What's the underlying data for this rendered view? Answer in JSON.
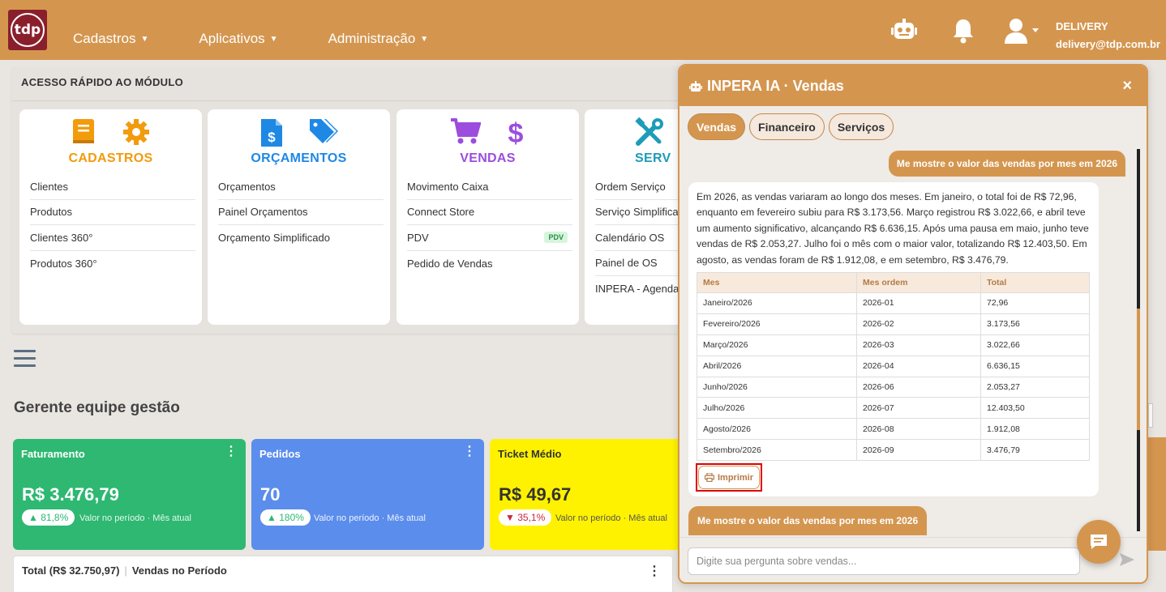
{
  "navbar": {
    "logo_text": "tdp",
    "menu": [
      {
        "label": "Cadastros"
      },
      {
        "label": "Aplicativos"
      },
      {
        "label": "Administração"
      }
    ],
    "user_name": "DELIVERY",
    "user_email": "delivery@tdp.com.br"
  },
  "quick_access": {
    "title": "ACESSO RÁPIDO AO MÓDULO",
    "cards": [
      {
        "title": "CADASTROS",
        "color": "#f29b0c",
        "items": [
          "Clientes",
          "Produtos",
          "Clientes 360°",
          "Produtos 360°"
        ]
      },
      {
        "title": "ORÇAMENTOS",
        "color": "#1e88e5",
        "items": [
          "Orçamentos",
          "Painel Orçamentos",
          "Orçamento Simplificado"
        ]
      },
      {
        "title": "VENDAS",
        "color": "#9c4ddd",
        "items": [
          "Movimento Caixa",
          "Connect Store",
          "PDV",
          "Pedido de Vendas"
        ],
        "badge": "PDV"
      },
      {
        "title": "SERV",
        "color": "#1c9cb8",
        "items": [
          "Ordem Serviço",
          "Serviço Simplifica",
          "Calendário OS",
          "Painel de OS",
          "INPERA - Agenda"
        ]
      }
    ]
  },
  "section_title": "Gerente equipe gestão",
  "kpis": [
    {
      "label": "Faturamento",
      "value": "R$ 3.476,79",
      "change": "81,8%",
      "meta": "Valor no período · Mês atual",
      "color": "#2eb872"
    },
    {
      "label": "Pedidos",
      "value": "70",
      "change": "180%",
      "meta": "Valor no período · Mês atual",
      "color": "#5b8dec"
    },
    {
      "label": "Ticket Médio",
      "value": "R$ 49,67",
      "change": "35,1%",
      "meta": "Valor no período · Mês atual",
      "color": "#fff200"
    }
  ],
  "total_card": {
    "total": "Total (R$ 32.750,97)",
    "label": "Vendas no Período"
  },
  "chat": {
    "title": "INPERA IA · Vendas",
    "close": "×",
    "tabs": [
      "Vendas",
      "Financeiro",
      "Serviços"
    ],
    "user_message": "Me mostre o valor das vendas por mes em 2026",
    "bot_text": "Em 2026, as vendas variaram ao longo dos meses. Em janeiro, o total foi de R$ 72,96, enquanto em fevereiro subiu para R$ 3.173,56. Março registrou R$ 3.022,66, e abril teve um aumento significativo, alcançando R$ 6.636,15. Após uma pausa em maio, junho teve vendas de R$ 2.053,27. Julho foi o mês com o maior valor, totalizando R$ 12.403,50. Em agosto, as vendas foram de R$ 1.912,08, e em setembro, R$ 3.476,79.",
    "table": {
      "headers": [
        "Mes",
        "Mes ordem",
        "Total"
      ],
      "rows": [
        [
          "Janeiro/2026",
          "2026-01",
          "72,96"
        ],
        [
          "Fevereiro/2026",
          "2026-02",
          "3.173,56"
        ],
        [
          "Março/2026",
          "2026-03",
          "3.022,66"
        ],
        [
          "Abril/2026",
          "2026-04",
          "6.636,15"
        ],
        [
          "Junho/2026",
          "2026-06",
          "2.053,27"
        ],
        [
          "Julho/2026",
          "2026-07",
          "12.403,50"
        ],
        [
          "Agosto/2026",
          "2026-08",
          "1.912,08"
        ],
        [
          "Setembro/2026",
          "2026-09",
          "3.476,79"
        ]
      ]
    },
    "print_label": "Imprimir",
    "user_message_2": "Me mostre o valor das vendas por mes em 2026",
    "input_placeholder": "Digite sua pergunta sobre vendas..."
  }
}
